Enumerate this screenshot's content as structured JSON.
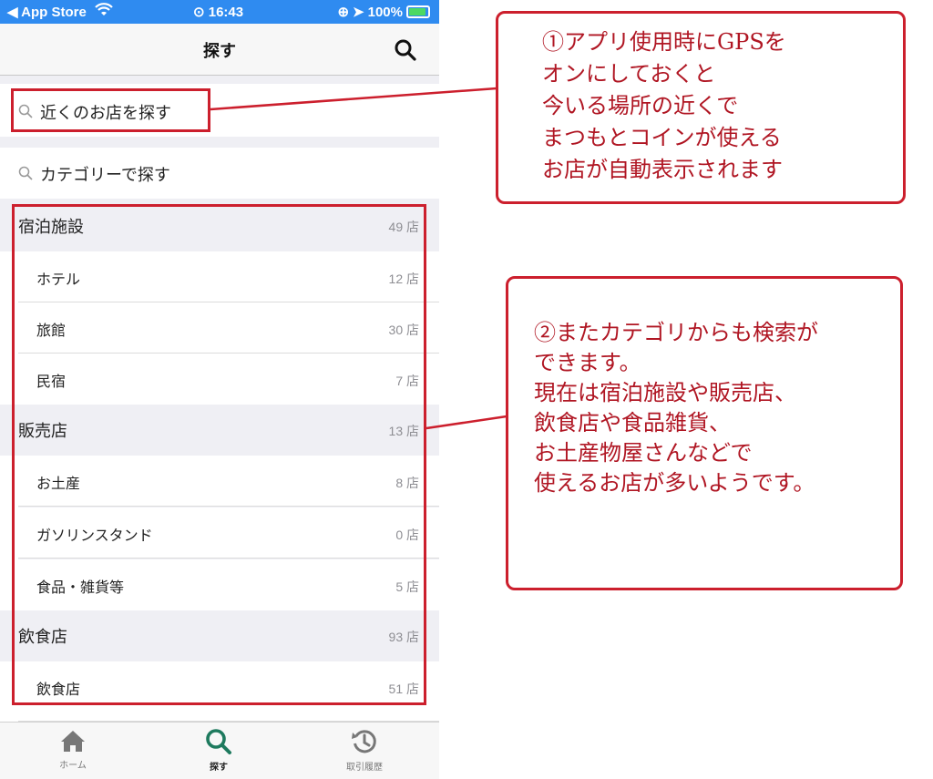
{
  "status_bar": {
    "back_app": "◀ App Store",
    "time": "16:43",
    "battery": "100%"
  },
  "nav": {
    "title": "探す"
  },
  "search_nearby": {
    "label": "近くのお店を探す"
  },
  "search_category": {
    "label": "カテゴリーで探す"
  },
  "count_suffix": "店",
  "categories": [
    {
      "name": "宿泊施設",
      "count": "49 店",
      "items": [
        {
          "name": "ホテル",
          "count": "12 店"
        },
        {
          "name": "旅館",
          "count": "30 店"
        },
        {
          "name": "民宿",
          "count": "7 店"
        }
      ]
    },
    {
      "name": "販売店",
      "count": "13 店",
      "items": [
        {
          "name": "お土産",
          "count": "8 店"
        },
        {
          "name": "ガソリンスタンド",
          "count": "0 店"
        },
        {
          "name": "食品・雑貨等",
          "count": "5 店"
        }
      ]
    },
    {
      "name": "飲食店",
      "count": "93 店",
      "items": [
        {
          "name": "飲食店",
          "count": "51 店"
        }
      ]
    }
  ],
  "tab_bar": {
    "home": "ホーム",
    "search": "探す",
    "history": "取引履歴"
  },
  "annotations": {
    "note1": "①アプリ使用時にGPSを\nオンにしておくと\n今いる場所の近くで\nまつもとコインが使える\nお店が自動表示されます",
    "note2": "②またカテゴリからも検索が\nできます。\n現在は宿泊施設や販売店、\n飲食店や食品雑貨、\nお土産物屋さんなどで\n使えるお店が多いようです。"
  },
  "colors": {
    "status_bar": "#2f8bf0",
    "accent_green": "#1e7a5e",
    "annotation_red": "#cc1f2d"
  }
}
